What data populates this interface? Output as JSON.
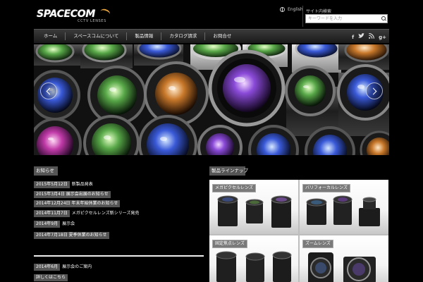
{
  "header": {
    "logo_text": "SPACECOM",
    "logo_tagline": "CCTV LENSES",
    "language": "English",
    "search_label": "サイト内検索",
    "search_placeholder": "キーワードを入力"
  },
  "nav": {
    "items": [
      "ホーム",
      "スペースコムについて",
      "製品情報",
      "カタログ請求",
      "お問合せ"
    ],
    "social": [
      "f",
      "t",
      "rss",
      "g+"
    ]
  },
  "news": {
    "heading": "お知らせ",
    "items": [
      {
        "date": "2015年5月12日",
        "text": "新製品発表"
      },
      {
        "date": "2015年3月4日 展示会出展のお知らせ",
        "text": ""
      },
      {
        "date": "2014年12月24日 年末年始休業のお知らせ",
        "text": ""
      },
      {
        "date": "2014年11月7日",
        "text": "メガピクセルレンズ新シリーズ発売"
      },
      {
        "date": "2014年9月",
        "text": "展示会"
      },
      {
        "date": "2014年7月18日 夏季休業のお知らせ",
        "text": ""
      }
    ],
    "second_item": {
      "date": "2014年6月",
      "text": "展示会のご案内"
    },
    "second_sub": "詳しくはこちら"
  },
  "products": {
    "heading": "製品ラインナップ",
    "categories": [
      {
        "label": "メガピクセルレンズ"
      },
      {
        "label": "バリフォーカルレンズ"
      },
      {
        "label": "固定焦点レンズ"
      },
      {
        "label": "ズームレンズ"
      }
    ]
  }
}
